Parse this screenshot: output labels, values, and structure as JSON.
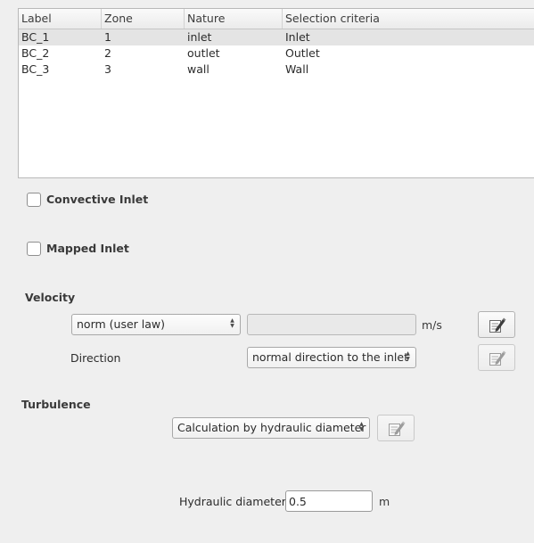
{
  "table": {
    "headers": [
      "Label",
      "Zone",
      "Nature",
      "Selection criteria"
    ],
    "rows": [
      [
        "BC_1",
        "1",
        "inlet",
        "Inlet"
      ],
      [
        "BC_2",
        "2",
        "outlet",
        "Outlet"
      ],
      [
        "BC_3",
        "3",
        "wall",
        "Wall"
      ]
    ]
  },
  "convective_inlet": {
    "label": "Convective Inlet",
    "checked": false
  },
  "mapped_inlet": {
    "label": "Mapped Inlet",
    "checked": false
  },
  "velocity": {
    "title": "Velocity",
    "mode": "norm (user law)",
    "value": "",
    "unit": "m/s",
    "direction_label": "Direction",
    "direction": "normal direction to the inlet",
    "formula_icon": "formula-editor-icon"
  },
  "turbulence": {
    "title": "Turbulence",
    "mode": "Calculation by hydraulic diameter",
    "formula_icon": "formula-editor-icon",
    "hydraulic_diameter_label": "Hydraulic diameter",
    "hydraulic_diameter": "0.5",
    "hydraulic_diameter_unit": "m"
  }
}
